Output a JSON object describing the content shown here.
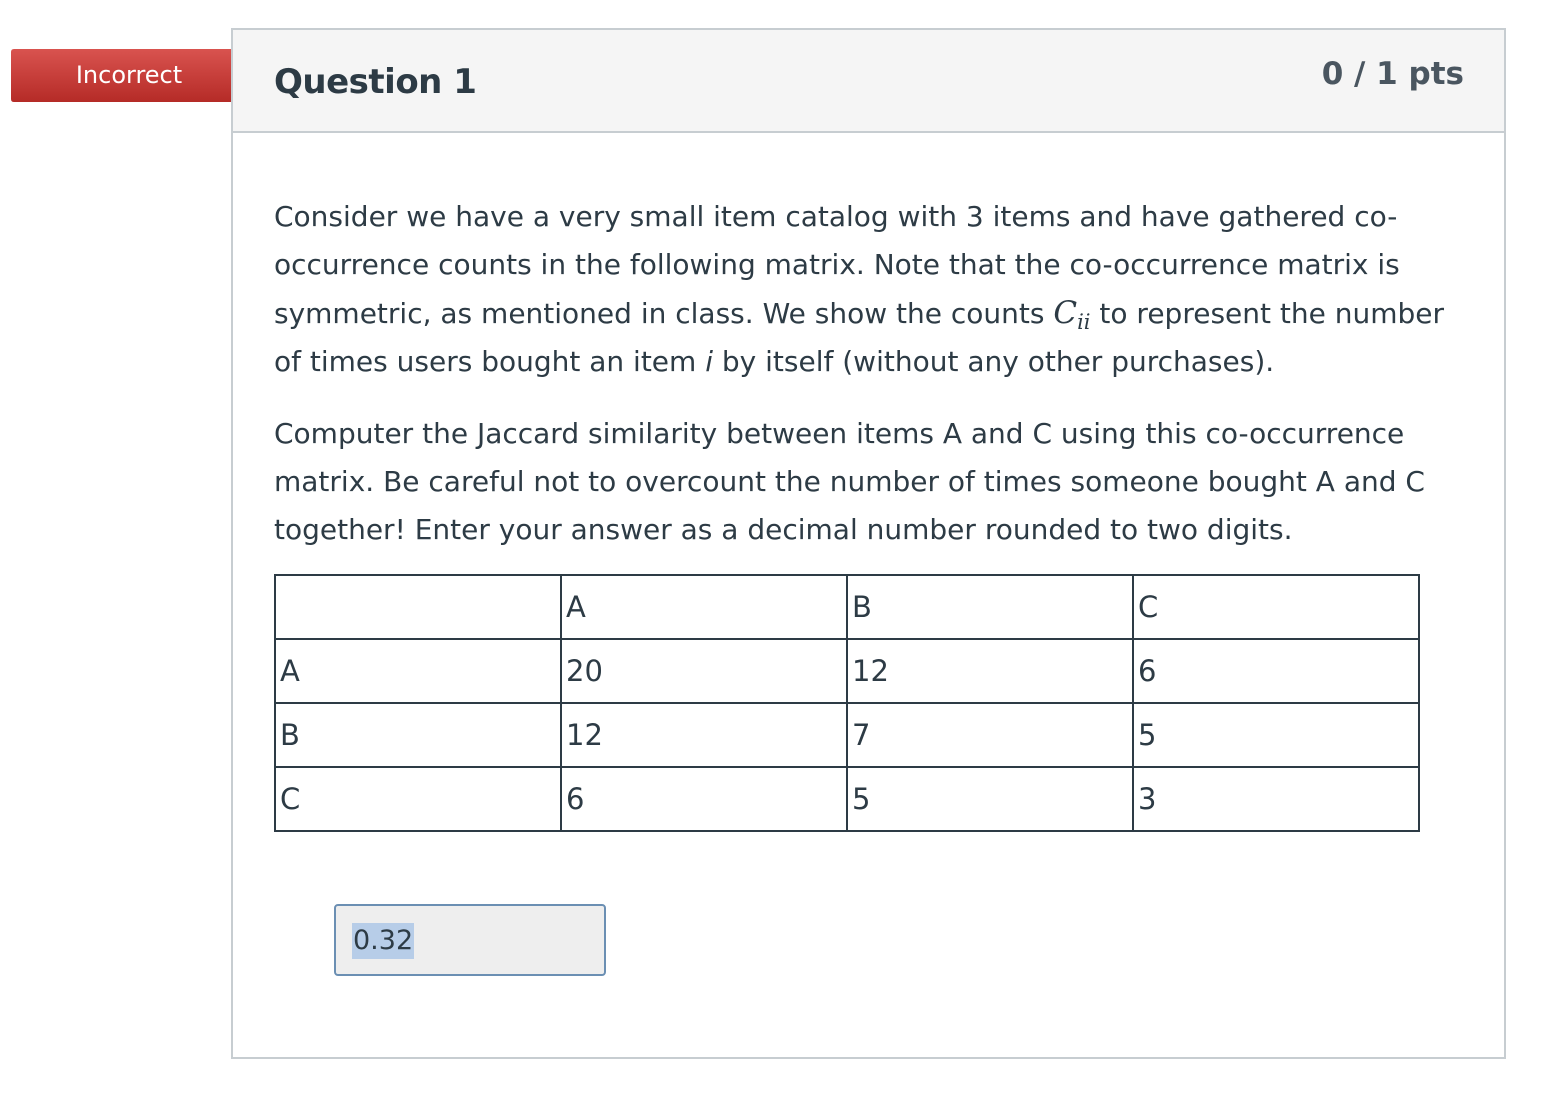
{
  "flag": {
    "label": "Incorrect",
    "color": "#c9302c"
  },
  "question": {
    "title": "Question 1",
    "points": "0 / 1 pts",
    "para1_part1": "Consider we have a very small item catalog with 3 items and have gathered co-occurrence counts in the following matrix. Note that the co-occurrence matrix is symmetric, as mentioned in class. We show the counts ",
    "math_symbol": "C",
    "math_subscript": "ii",
    "para1_part2": " to represent the number of times users bought an item ",
    "para1_italic": "i",
    "para1_part3": " by itself (without any other purchases).",
    "para2": "Computer the Jaccard similarity between items A and C using this co-occurrence matrix. Be careful not to overcount the number of times someone bought A and C together! Enter your answer as a decimal number rounded to two digits."
  },
  "matrix": {
    "header": [
      "",
      "A",
      "B",
      "C"
    ],
    "rows": [
      [
        "A",
        "20",
        "12",
        "6"
      ],
      [
        "B",
        "12",
        "7",
        "5"
      ],
      [
        "C",
        "6",
        "5",
        "3"
      ]
    ]
  },
  "answer": {
    "value": "0.32"
  }
}
